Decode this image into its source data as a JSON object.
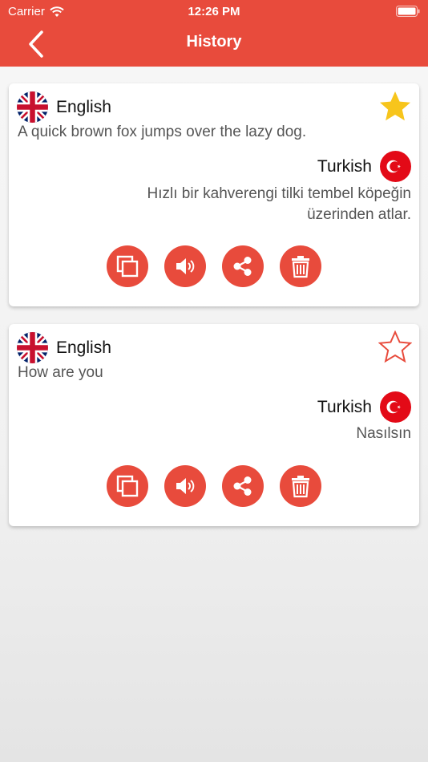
{
  "status_bar": {
    "carrier": "Carrier",
    "time": "12:26 PM"
  },
  "nav": {
    "title": "History",
    "back_icon": "chevron-left-icon"
  },
  "colors": {
    "accent": "#e84b3c",
    "star_gold": "#f7c51c"
  },
  "history": [
    {
      "source_lang": "English",
      "source_text": "A quick brown fox jumps over the lazy dog.",
      "target_lang": "Turkish",
      "target_text": "Hızlı bir kahverengi tilki tembel köpeğin üzerinden atlar.",
      "favorite": true
    },
    {
      "source_lang": "English",
      "source_text": "How are you",
      "target_lang": "Turkish",
      "target_text": "Nasılsın",
      "favorite": false
    }
  ],
  "actions": [
    "copy-icon",
    "speaker-icon",
    "share-icon",
    "trash-icon"
  ]
}
